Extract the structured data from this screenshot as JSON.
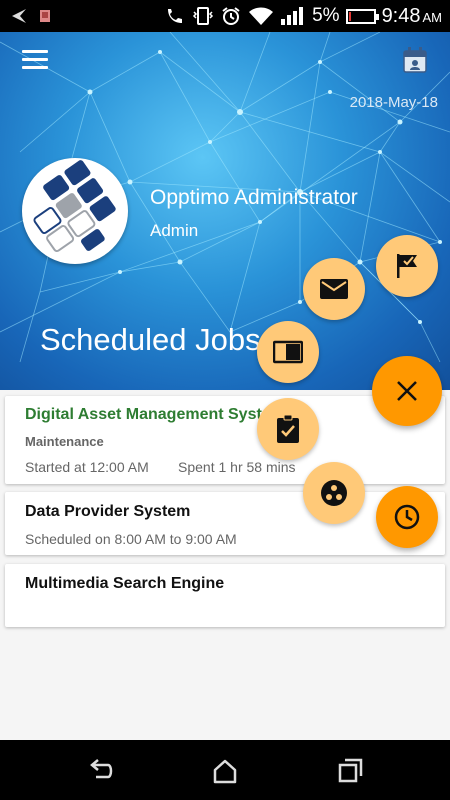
{
  "status_bar": {
    "battery_percent": "5%",
    "battery_level": 0.05,
    "time": "9:48",
    "ampm": "AM",
    "icons": [
      "back-arrow-icon",
      "notification-icon",
      "call-icon",
      "vibrate-icon",
      "alarm-icon",
      "wifi-icon",
      "signal-icon"
    ]
  },
  "header": {
    "date": "2018-May-18",
    "user_name": "Opptimo Administrator",
    "user_role": "Admin",
    "page_title": "Scheduled Jobs",
    "menu_icon": "menu-icon",
    "calendar_icon": "calendar-icon"
  },
  "jobs": [
    {
      "title": "Digital Asset Management Syst",
      "category": "Maintenance",
      "started": "Started at 12:00 AM",
      "spent": "Spent 1 hr 58 mins",
      "title_color": "#2e7d32"
    },
    {
      "title": "Data Provider System",
      "schedule": "Scheduled on 8:00 AM to 9:00 AM"
    },
    {
      "title": "Multimedia Search Engine"
    }
  ],
  "fab_menu": {
    "items": [
      "flag-icon",
      "mail-icon",
      "view-list-icon",
      "close-icon",
      "assignment-turned-in-icon",
      "group-work-icon",
      "clock-icon"
    ],
    "accent": "#ff9800",
    "light_accent": "#ffc978"
  },
  "nav_bar": {
    "icons": [
      "back-icon",
      "home-icon",
      "recents-icon"
    ]
  }
}
